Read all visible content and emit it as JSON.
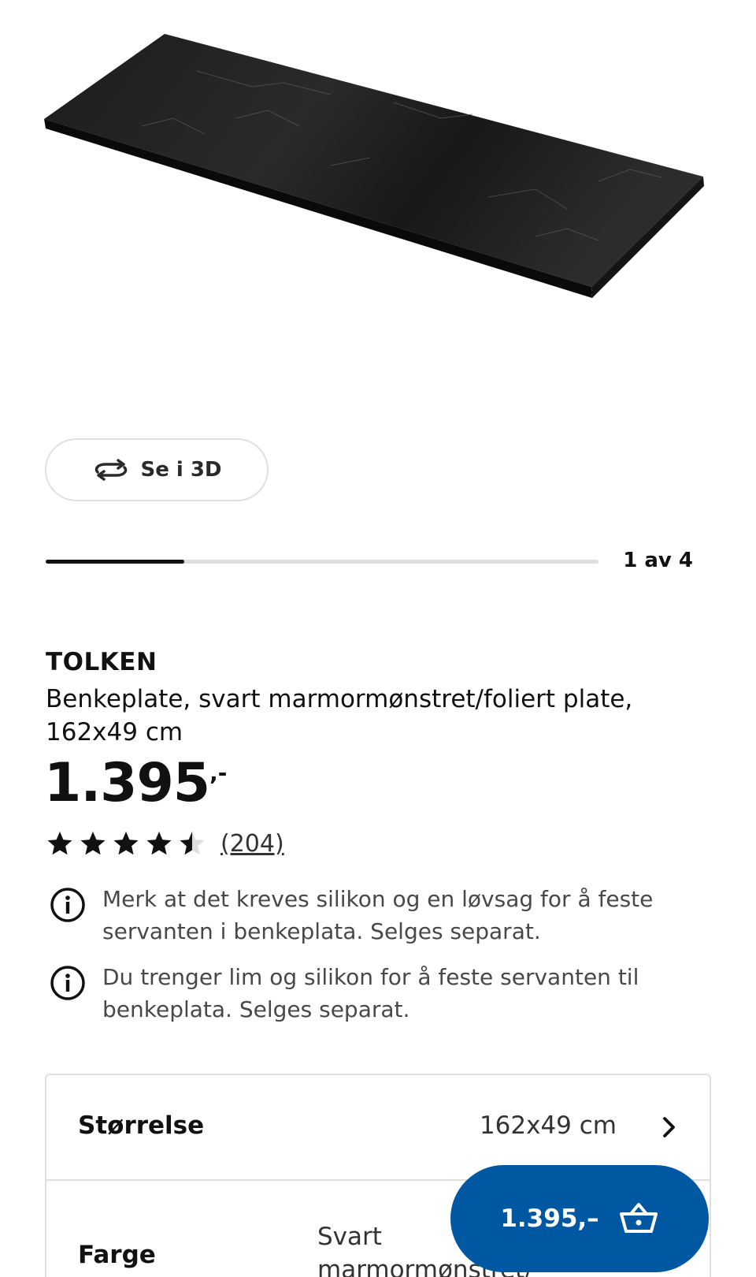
{
  "gallery": {
    "view_3d_label": "Se i 3D",
    "counter_text": "1 av 4",
    "current_image": 1,
    "total_images": 4,
    "product_image": "black marble-patterned worktop"
  },
  "product": {
    "name": "TOLKEN",
    "description": "Benkeplate, svart marmormønstret/foliert plate, 162x49 cm",
    "price_main": "1.395",
    "price_suffix": ",-"
  },
  "rating": {
    "stars": 4.5,
    "max_stars": 5,
    "review_count": "(204)"
  },
  "notices": [
    {
      "icon": "info-icon",
      "text": "Merk at det kreves silikon og en løvsag for å feste servanten i benkeplata. Selges separat."
    },
    {
      "icon": "info-icon",
      "text": "Du trenger lim og silikon for å feste servanten til benkeplata. Selges separat."
    }
  ],
  "options": {
    "size": {
      "label": "Størrelse",
      "value": "162x49 cm",
      "icon": "chevron-right-icon"
    },
    "color": {
      "label": "Farge",
      "value": "Svart marmormønstret/ foliert plate"
    }
  },
  "cart_button": {
    "price_label": "1.395,–",
    "icon": "basket-icon",
    "background": "#0058a3"
  },
  "colors": {
    "accent": "#0058a3",
    "text": "#111111",
    "border": "#dfdfdf"
  }
}
